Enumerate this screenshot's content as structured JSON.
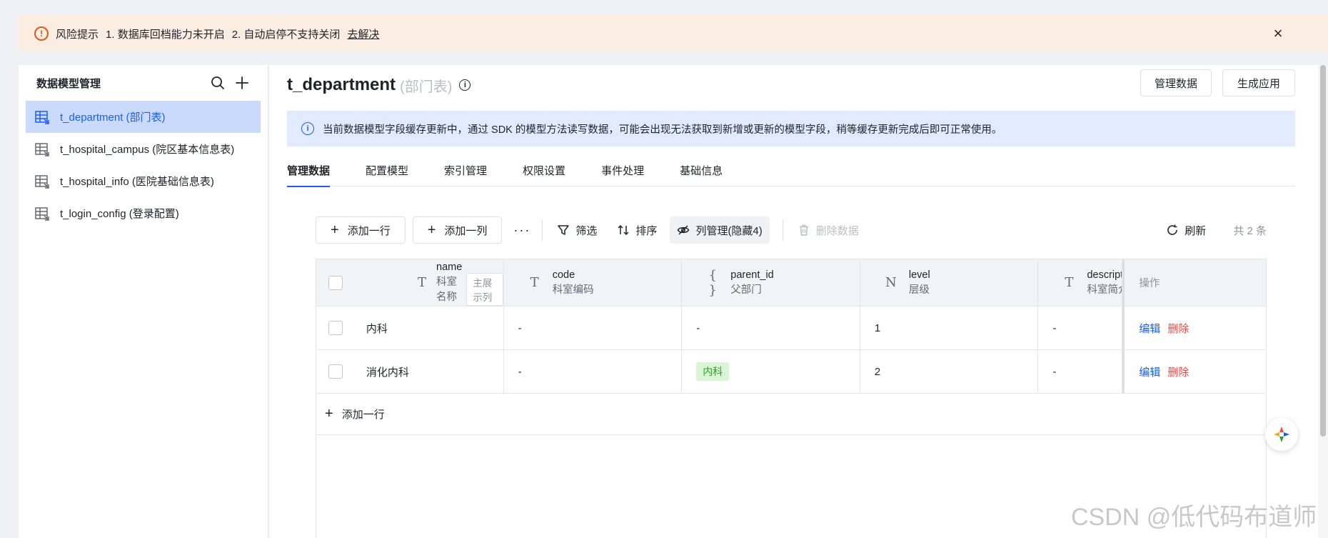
{
  "alert": {
    "title": "风险提示",
    "item1": "1. 数据库回档能力未开启",
    "item2": "2. 自动启停不支持关闭",
    "link": "去解决",
    "close": "×"
  },
  "sidebar": {
    "title": "数据模型管理",
    "items": [
      {
        "label": "t_department (部门表)"
      },
      {
        "label": "t_hospital_campus (院区基本信息表)"
      },
      {
        "label": "t_hospital_info (医院基础信息表)"
      },
      {
        "label": "t_login_config (登录配置)"
      }
    ]
  },
  "header": {
    "title": "t_department",
    "subtitle": "(部门表)",
    "info": "i",
    "manage_button": "管理数据",
    "generate_button": "生成应用"
  },
  "notice": {
    "icon": "i",
    "text": "当前数据模型字段缓存更新中，通过 SDK 的模型方法读写数据，可能会出现无法获取到新增或更新的模型字段，稍等缓存更新完成后即可正常使用。"
  },
  "tabs": [
    {
      "label": "管理数据"
    },
    {
      "label": "配置模型"
    },
    {
      "label": "索引管理"
    },
    {
      "label": "权限设置"
    },
    {
      "label": "事件处理"
    },
    {
      "label": "基础信息"
    }
  ],
  "toolbar": {
    "plus": "+",
    "add_row": "添加一行",
    "add_col": "添加一列",
    "more": "···",
    "filter": "筛选",
    "sort": "排序",
    "columns": "列管理(隐藏4)",
    "delete": "删除数据",
    "refresh": "刷新",
    "count": "共 2 条"
  },
  "table": {
    "columns": [
      {
        "type_icon": "T",
        "field": "name",
        "label": "科室名称",
        "tag": "主展示列"
      },
      {
        "type_icon": "T",
        "field": "code",
        "label": "科室编码"
      },
      {
        "type_icon": "{ }",
        "field": "parent_id",
        "label": "父部门"
      },
      {
        "type_icon": "N",
        "field": "level",
        "label": "层级"
      },
      {
        "type_icon": "T",
        "field": "description",
        "label": "科室简介"
      }
    ],
    "ops_header": "操作",
    "rows": [
      {
        "name": "内科",
        "code": "-",
        "parent": "-",
        "level": "1",
        "desc": "-"
      },
      {
        "name": "消化内科",
        "code": "-",
        "parent": "内科",
        "level": "2",
        "desc": "-"
      }
    ],
    "edit": "编辑",
    "delete": "删除",
    "add_row": "添加一行"
  },
  "watermark": "CSDN @低代码布道师",
  "colors": {
    "accent": "#1b5ef5",
    "danger": "#f54a45",
    "warning": "#e2581c",
    "active_bg": "#c9dafd",
    "notice_bg": "#e1eaff",
    "alert_bg": "#fcede3"
  }
}
